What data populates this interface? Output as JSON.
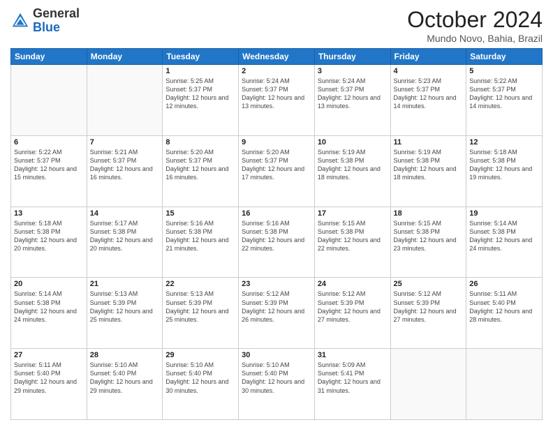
{
  "header": {
    "logo_general": "General",
    "logo_blue": "Blue",
    "month_title": "October 2024",
    "location": "Mundo Novo, Bahia, Brazil"
  },
  "days_of_week": [
    "Sunday",
    "Monday",
    "Tuesday",
    "Wednesday",
    "Thursday",
    "Friday",
    "Saturday"
  ],
  "weeks": [
    [
      {
        "day": "",
        "info": ""
      },
      {
        "day": "",
        "info": ""
      },
      {
        "day": "1",
        "sunrise": "5:25 AM",
        "sunset": "5:37 PM",
        "daylight": "12 hours and 12 minutes."
      },
      {
        "day": "2",
        "sunrise": "5:24 AM",
        "sunset": "5:37 PM",
        "daylight": "12 hours and 13 minutes."
      },
      {
        "day": "3",
        "sunrise": "5:24 AM",
        "sunset": "5:37 PM",
        "daylight": "12 hours and 13 minutes."
      },
      {
        "day": "4",
        "sunrise": "5:23 AM",
        "sunset": "5:37 PM",
        "daylight": "12 hours and 14 minutes."
      },
      {
        "day": "5",
        "sunrise": "5:22 AM",
        "sunset": "5:37 PM",
        "daylight": "12 hours and 14 minutes."
      }
    ],
    [
      {
        "day": "6",
        "sunrise": "5:22 AM",
        "sunset": "5:37 PM",
        "daylight": "12 hours and 15 minutes."
      },
      {
        "day": "7",
        "sunrise": "5:21 AM",
        "sunset": "5:37 PM",
        "daylight": "12 hours and 16 minutes."
      },
      {
        "day": "8",
        "sunrise": "5:20 AM",
        "sunset": "5:37 PM",
        "daylight": "12 hours and 16 minutes."
      },
      {
        "day": "9",
        "sunrise": "5:20 AM",
        "sunset": "5:37 PM",
        "daylight": "12 hours and 17 minutes."
      },
      {
        "day": "10",
        "sunrise": "5:19 AM",
        "sunset": "5:38 PM",
        "daylight": "12 hours and 18 minutes."
      },
      {
        "day": "11",
        "sunrise": "5:19 AM",
        "sunset": "5:38 PM",
        "daylight": "12 hours and 18 minutes."
      },
      {
        "day": "12",
        "sunrise": "5:18 AM",
        "sunset": "5:38 PM",
        "daylight": "12 hours and 19 minutes."
      }
    ],
    [
      {
        "day": "13",
        "sunrise": "5:18 AM",
        "sunset": "5:38 PM",
        "daylight": "12 hours and 20 minutes."
      },
      {
        "day": "14",
        "sunrise": "5:17 AM",
        "sunset": "5:38 PM",
        "daylight": "12 hours and 20 minutes."
      },
      {
        "day": "15",
        "sunrise": "5:16 AM",
        "sunset": "5:38 PM",
        "daylight": "12 hours and 21 minutes."
      },
      {
        "day": "16",
        "sunrise": "5:16 AM",
        "sunset": "5:38 PM",
        "daylight": "12 hours and 22 minutes."
      },
      {
        "day": "17",
        "sunrise": "5:15 AM",
        "sunset": "5:38 PM",
        "daylight": "12 hours and 22 minutes."
      },
      {
        "day": "18",
        "sunrise": "5:15 AM",
        "sunset": "5:38 PM",
        "daylight": "12 hours and 23 minutes."
      },
      {
        "day": "19",
        "sunrise": "5:14 AM",
        "sunset": "5:38 PM",
        "daylight": "12 hours and 24 minutes."
      }
    ],
    [
      {
        "day": "20",
        "sunrise": "5:14 AM",
        "sunset": "5:38 PM",
        "daylight": "12 hours and 24 minutes."
      },
      {
        "day": "21",
        "sunrise": "5:13 AM",
        "sunset": "5:39 PM",
        "daylight": "12 hours and 25 minutes."
      },
      {
        "day": "22",
        "sunrise": "5:13 AM",
        "sunset": "5:39 PM",
        "daylight": "12 hours and 25 minutes."
      },
      {
        "day": "23",
        "sunrise": "5:12 AM",
        "sunset": "5:39 PM",
        "daylight": "12 hours and 26 minutes."
      },
      {
        "day": "24",
        "sunrise": "5:12 AM",
        "sunset": "5:39 PM",
        "daylight": "12 hours and 27 minutes."
      },
      {
        "day": "25",
        "sunrise": "5:12 AM",
        "sunset": "5:39 PM",
        "daylight": "12 hours and 27 minutes."
      },
      {
        "day": "26",
        "sunrise": "5:11 AM",
        "sunset": "5:40 PM",
        "daylight": "12 hours and 28 minutes."
      }
    ],
    [
      {
        "day": "27",
        "sunrise": "5:11 AM",
        "sunset": "5:40 PM",
        "daylight": "12 hours and 29 minutes."
      },
      {
        "day": "28",
        "sunrise": "5:10 AM",
        "sunset": "5:40 PM",
        "daylight": "12 hours and 29 minutes."
      },
      {
        "day": "29",
        "sunrise": "5:10 AM",
        "sunset": "5:40 PM",
        "daylight": "12 hours and 30 minutes."
      },
      {
        "day": "30",
        "sunrise": "5:10 AM",
        "sunset": "5:40 PM",
        "daylight": "12 hours and 30 minutes."
      },
      {
        "day": "31",
        "sunrise": "5:09 AM",
        "sunset": "5:41 PM",
        "daylight": "12 hours and 31 minutes."
      },
      {
        "day": "",
        "info": ""
      },
      {
        "day": "",
        "info": ""
      }
    ]
  ]
}
